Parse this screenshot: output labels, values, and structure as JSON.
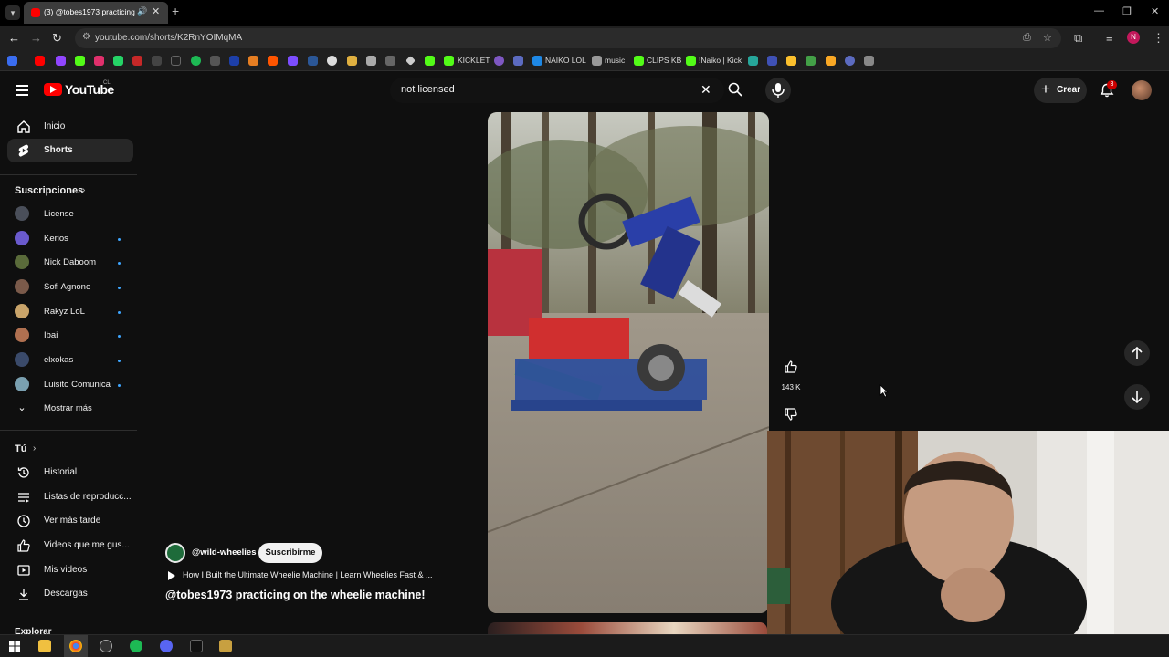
{
  "browser": {
    "tab_title": "(3) @tobes1973 practicing",
    "url": "youtube.com/shorts/K2RnYOIMqMA",
    "bookmarks": [
      "KICKLET",
      "NAIKO LOL",
      "music",
      "CLIPS KB",
      "!Naiko | Kick"
    ]
  },
  "header": {
    "logo_text": "YouTube",
    "country": "CL",
    "search_value": "not licensed",
    "create_label": "Crear",
    "notification_count": "3"
  },
  "sidebar": {
    "main": [
      {
        "label": "Inicio",
        "icon": "home-icon"
      },
      {
        "label": "Shorts",
        "icon": "shorts-icon"
      }
    ],
    "subscriptions_title": "Suscripciones",
    "subscriptions": [
      {
        "label": "License"
      },
      {
        "label": "Kerios"
      },
      {
        "label": "Nick Daboom"
      },
      {
        "label": "Sofi Agnone"
      },
      {
        "label": "Rakyz LoL"
      },
      {
        "label": "Ibai"
      },
      {
        "label": "elxokas"
      },
      {
        "label": "Luisito Comunica"
      }
    ],
    "show_more": "Mostrar más",
    "you_title": "Tú",
    "you_items": [
      {
        "label": "Historial",
        "icon": "history-icon"
      },
      {
        "label": "Listas de reproducc...",
        "icon": "playlist-icon"
      },
      {
        "label": "Ver más tarde",
        "icon": "clock-icon"
      },
      {
        "label": "Videos que me gus...",
        "icon": "thumbs-up-icon"
      },
      {
        "label": "Mis videos",
        "icon": "my-videos-icon"
      },
      {
        "label": "Descargas",
        "icon": "download-icon"
      }
    ],
    "explore_title": "Explorar"
  },
  "short": {
    "channel": "@wild-wheelies",
    "subscribe_label": "Suscribirme",
    "related_video": "How I Built the Ultimate Wheelie Machine | Learn Wheelies Fast & ...",
    "title": "@tobes1973 practicing on the wheelie machine!",
    "likes": "143 K"
  },
  "colors": {
    "background": "#0f0f0f",
    "accent_red": "#ff0000",
    "subscribe_bg": "#f1f1f1"
  }
}
